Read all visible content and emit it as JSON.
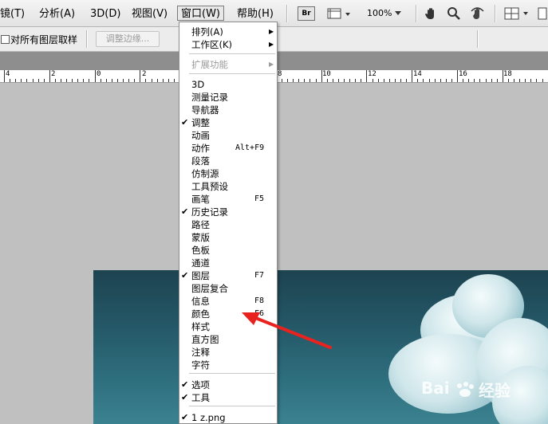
{
  "menubar": {
    "items": [
      {
        "label": "镜(T)"
      },
      {
        "label": "分析(A)"
      },
      {
        "label": "3D(D)"
      },
      {
        "label": "视图(V)"
      },
      {
        "label": "窗口(W)"
      },
      {
        "label": "帮助(H)"
      }
    ],
    "bridge_label": "Br",
    "zoom_value": "100%"
  },
  "options_bar": {
    "sample_all_layers_label": "对所有图层取样",
    "refine_edge_label": "调整边缘..."
  },
  "ruler": {
    "labels": [
      "4",
      "2",
      "0",
      "2",
      "4",
      "6",
      "8",
      "10",
      "12",
      "14",
      "16",
      "18"
    ]
  },
  "window_menu": {
    "items": [
      {
        "label": "排列(A)",
        "submenu": true
      },
      {
        "label": "工作区(K)",
        "submenu": true
      },
      {
        "label": "扩展功能",
        "submenu": true,
        "disabled": true
      },
      {
        "label": "3D"
      },
      {
        "label": "测量记录"
      },
      {
        "label": "导航器"
      },
      {
        "label": "调整",
        "checked": true
      },
      {
        "label": "动画"
      },
      {
        "label": "动作",
        "shortcut": "Alt+F9"
      },
      {
        "label": "段落"
      },
      {
        "label": "仿制源"
      },
      {
        "label": "工具预设"
      },
      {
        "label": "画笔",
        "shortcut": "F5"
      },
      {
        "label": "历史记录",
        "checked": true
      },
      {
        "label": "路径"
      },
      {
        "label": "蒙版"
      },
      {
        "label": "色板"
      },
      {
        "label": "通道"
      },
      {
        "label": "图层",
        "checked": true,
        "shortcut": "F7"
      },
      {
        "label": "图层复合"
      },
      {
        "label": "信息",
        "shortcut": "F8"
      },
      {
        "label": "颜色",
        "shortcut": "F6"
      },
      {
        "label": "样式"
      },
      {
        "label": "直方图"
      },
      {
        "label": "注释"
      },
      {
        "label": "字符"
      },
      {
        "label": "选项",
        "checked": true
      },
      {
        "label": "工具",
        "checked": true
      },
      {
        "label": "1 z.png",
        "checked": true
      }
    ],
    "check_mark": "✔",
    "arrow_mark": "▶"
  },
  "watermark": {
    "text": "经验"
  },
  "colors": {
    "arrow": "#e8231f",
    "canvas_sky": "#245766"
  }
}
